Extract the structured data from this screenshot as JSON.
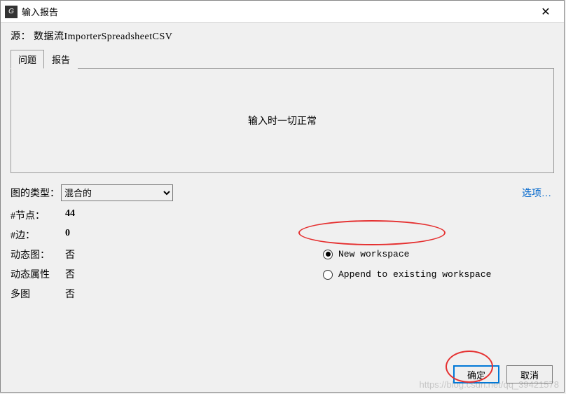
{
  "titlebar": {
    "title": "输入报告"
  },
  "source": {
    "label": "源：",
    "value": "数据流ImporterSpreadsheetCSV"
  },
  "tabs": {
    "items": [
      {
        "label": "问题",
        "active": true
      },
      {
        "label": "报告",
        "active": false
      }
    ]
  },
  "panel": {
    "message": "输入时一切正常"
  },
  "graph_type": {
    "label": "图的类型：",
    "selected": "混合的"
  },
  "options_link": "选项…",
  "stats": {
    "nodes": {
      "label": "#节点：",
      "value": "44"
    },
    "edges": {
      "label": "#边：",
      "value": "0"
    },
    "dynamic_graph": {
      "label": "动态图：",
      "value": "否"
    },
    "dynamic_attr": {
      "label": "动态属性",
      "value": "否"
    },
    "multi_graph": {
      "label": "多图",
      "value": "否"
    }
  },
  "workspace": {
    "new_label": "New workspace",
    "append_label": "Append to existing workspace",
    "selected": "new"
  },
  "buttons": {
    "ok": "确定",
    "cancel": "取消"
  },
  "watermark": "https://blog.csdn.net/qq_39421578"
}
